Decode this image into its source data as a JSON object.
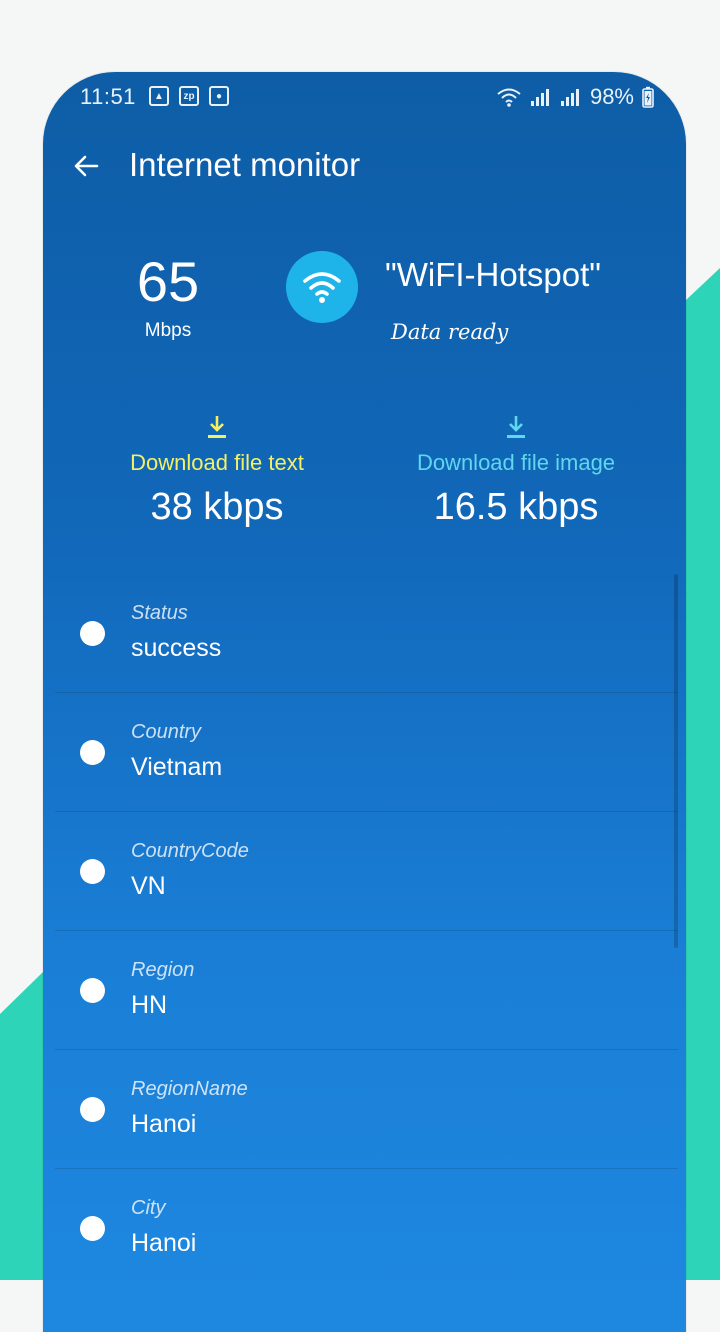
{
  "status_bar": {
    "time": "11:51",
    "battery": "98%"
  },
  "appbar": {
    "title": "Internet monitor"
  },
  "connection": {
    "speed_value": "65",
    "speed_unit": "Mbps",
    "ssid": "\"WiFI-Hotspot\"",
    "state": "Data ready"
  },
  "downloads": {
    "text": {
      "label": "Download file text",
      "value": "38 kbps"
    },
    "image": {
      "label": "Download file image",
      "value": "16.5 kbps"
    }
  },
  "info": [
    {
      "label": "Status",
      "value": "success"
    },
    {
      "label": "Country",
      "value": "Vietnam"
    },
    {
      "label": "CountryCode",
      "value": "VN"
    },
    {
      "label": "Region",
      "value": "HN"
    },
    {
      "label": "RegionName",
      "value": "Hanoi"
    },
    {
      "label": "City",
      "value": "Hanoi"
    }
  ],
  "colors": {
    "accent_teal": "#2dd4b8",
    "wifi_circle": "#1eb4ea",
    "download_text_label": "#f4f064",
    "download_image_label": "#5fd7ef"
  }
}
